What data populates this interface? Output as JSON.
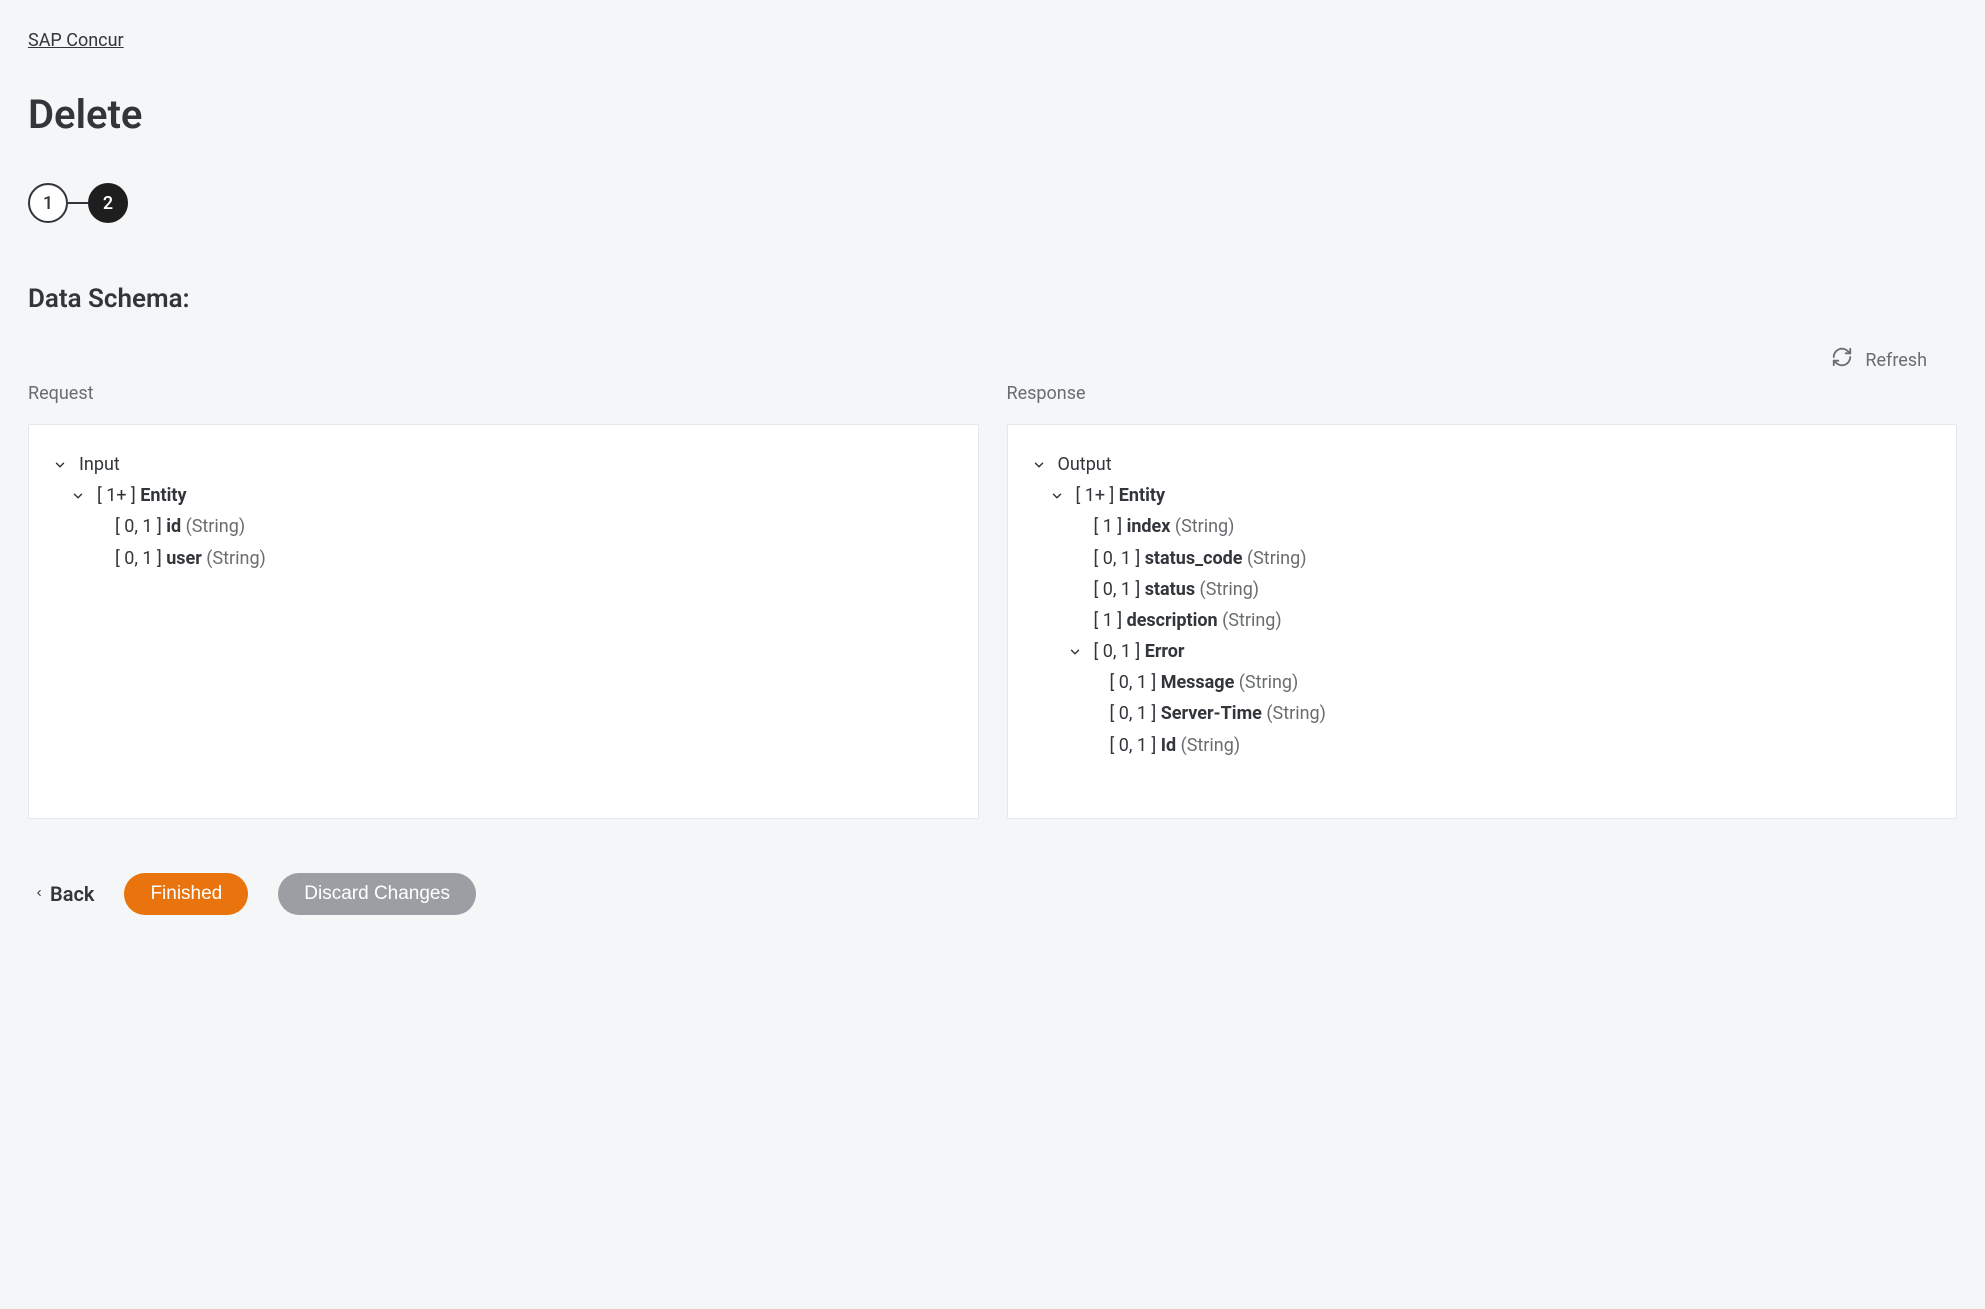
{
  "breadcrumb": "SAP Concur",
  "title": "Delete",
  "stepper": {
    "step1": "1",
    "step2": "2"
  },
  "section_title": "Data Schema:",
  "refresh_label": "Refresh",
  "request": {
    "label": "Request",
    "root": "Input",
    "entity": {
      "card": "[ 1+ ]",
      "name": "Entity"
    },
    "fields": [
      {
        "card": "[ 0, 1 ]",
        "name": "id",
        "type": "(String)"
      },
      {
        "card": "[ 0, 1 ]",
        "name": "user",
        "type": "(String)"
      }
    ]
  },
  "response": {
    "label": "Response",
    "root": "Output",
    "entity": {
      "card": "[ 1+ ]",
      "name": "Entity"
    },
    "fields": [
      {
        "card": "[ 1 ]",
        "name": "index",
        "type": "(String)"
      },
      {
        "card": "[ 0, 1 ]",
        "name": "status_code",
        "type": "(String)"
      },
      {
        "card": "[ 0, 1 ]",
        "name": "status",
        "type": "(String)"
      },
      {
        "card": "[ 1 ]",
        "name": "description",
        "type": "(String)"
      }
    ],
    "error": {
      "card": "[ 0, 1 ]",
      "name": "Error"
    },
    "error_fields": [
      {
        "card": "[ 0, 1 ]",
        "name": "Message",
        "type": "(String)"
      },
      {
        "card": "[ 0, 1 ]",
        "name": "Server-Time",
        "type": "(String)"
      },
      {
        "card": "[ 0, 1 ]",
        "name": "Id",
        "type": "(String)"
      }
    ]
  },
  "footer": {
    "back": "Back",
    "finished": "Finished",
    "discard": "Discard Changes"
  }
}
